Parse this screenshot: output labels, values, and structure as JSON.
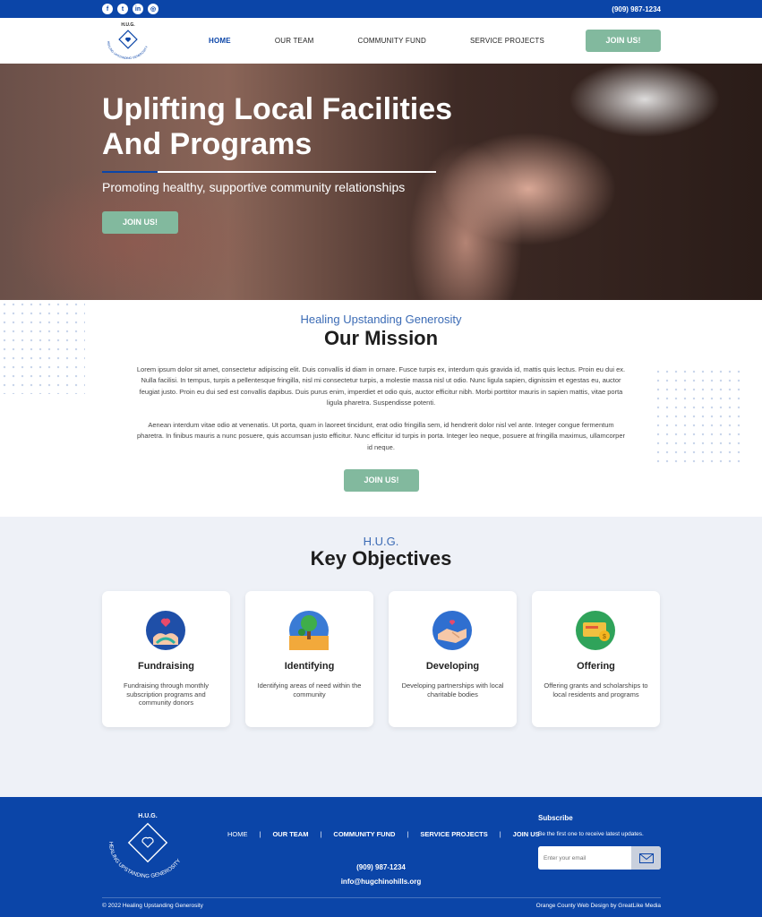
{
  "topbar": {
    "social": [
      {
        "name": "facebook-icon",
        "glyph": "f"
      },
      {
        "name": "twitter-icon",
        "glyph": "t"
      },
      {
        "name": "linkedin-icon",
        "glyph": "in"
      },
      {
        "name": "instagram-icon",
        "glyph": "◎"
      }
    ],
    "phone": "(909) 987-1234"
  },
  "header": {
    "logo_text": "H.U.G.",
    "logo_ring_text": "HEALING UPSTANDING GENEROSITY",
    "nav": [
      "HOME",
      "OUR TEAM",
      "COMMUNITY FUND",
      "SERVICE PROJECTS"
    ],
    "cta": "JOIN US!"
  },
  "hero": {
    "title_line1": "Uplifting Local Facilities",
    "title_line2": "And Programs",
    "subtitle": "Promoting healthy, supportive community relationships",
    "cta": "JOIN US!"
  },
  "mission": {
    "eyebrow": "Healing Upstanding Generosity",
    "title": "Our Mission",
    "para1": "Lorem ipsum dolor sit amet, consectetur adipiscing elit. Duis convallis id diam in ornare. Fusce turpis ex, interdum quis gravida id, mattis quis lectus. Proin eu dui ex. Nulla facilisi. In tempus, turpis a pellentesque fringilla, nisl mi consectetur turpis, a molestie massa nisl ut odio. Nunc ligula sapien, dignissim et egestas eu, auctor feugiat justo. Proin eu dui sed est convallis dapibus. Duis purus enim, imperdiet et odio quis, auctor efficitur nibh. Morbi porttitor mauris in sapien mattis, vitae porta ligula pharetra. Suspendisse potenti.",
    "para2": "Aenean interdum vitae odio at venenatis. Ut porta, quam in laoreet tincidunt, erat odio fringilla sem, id hendrerit dolor nisl vel ante. Integer congue fermentum pharetra. In finibus mauris a nunc posuere, quis accumsan justo efficitur. Nunc efficitur id turpis in porta. Integer leo neque, posuere at fringilla maximus, ullamcorper id neque.",
    "cta": "JOIN US!"
  },
  "objectives": {
    "eyebrow": "H.U.G.",
    "title": "Key Objectives",
    "cards": [
      {
        "title": "Fundraising",
        "text": "Fundraising through monthly subscription programs and community donors",
        "icon": "heart-hands-icon"
      },
      {
        "title": "Identifying",
        "text": "Identifying areas of need within the community",
        "icon": "tree-icon"
      },
      {
        "title": "Developing",
        "text": "Developing partnerships with local charitable bodies",
        "icon": "handshake-heart-icon"
      },
      {
        "title": "Offering",
        "text": "Offering grants and scholarships to local residents and programs",
        "icon": "money-icon"
      }
    ]
  },
  "footer": {
    "logo_text": "H.U.G.",
    "logo_ring_text": "HEALING UPSTANDING GENEROSITY",
    "nav": [
      "HOME",
      "OUR TEAM",
      "COMMUNITY FUND",
      "SERVICE PROJECTS",
      "JOIN US"
    ],
    "separator": "|",
    "phone": "(909) 987-1234",
    "email": "info@hugchinohills.org",
    "subscribe_title": "Subscribe",
    "subscribe_text": "Be the first one to receive latest updates.",
    "email_placeholder": "Enter your email",
    "copyright": "© 2022 Healing Upstanding Generosity",
    "credit": "Orange County Web Design by GreatLike Media"
  },
  "colors": {
    "brand_blue": "#0b45a8",
    "accent_green": "#82b99e",
    "section_bg": "#eef1f7"
  }
}
